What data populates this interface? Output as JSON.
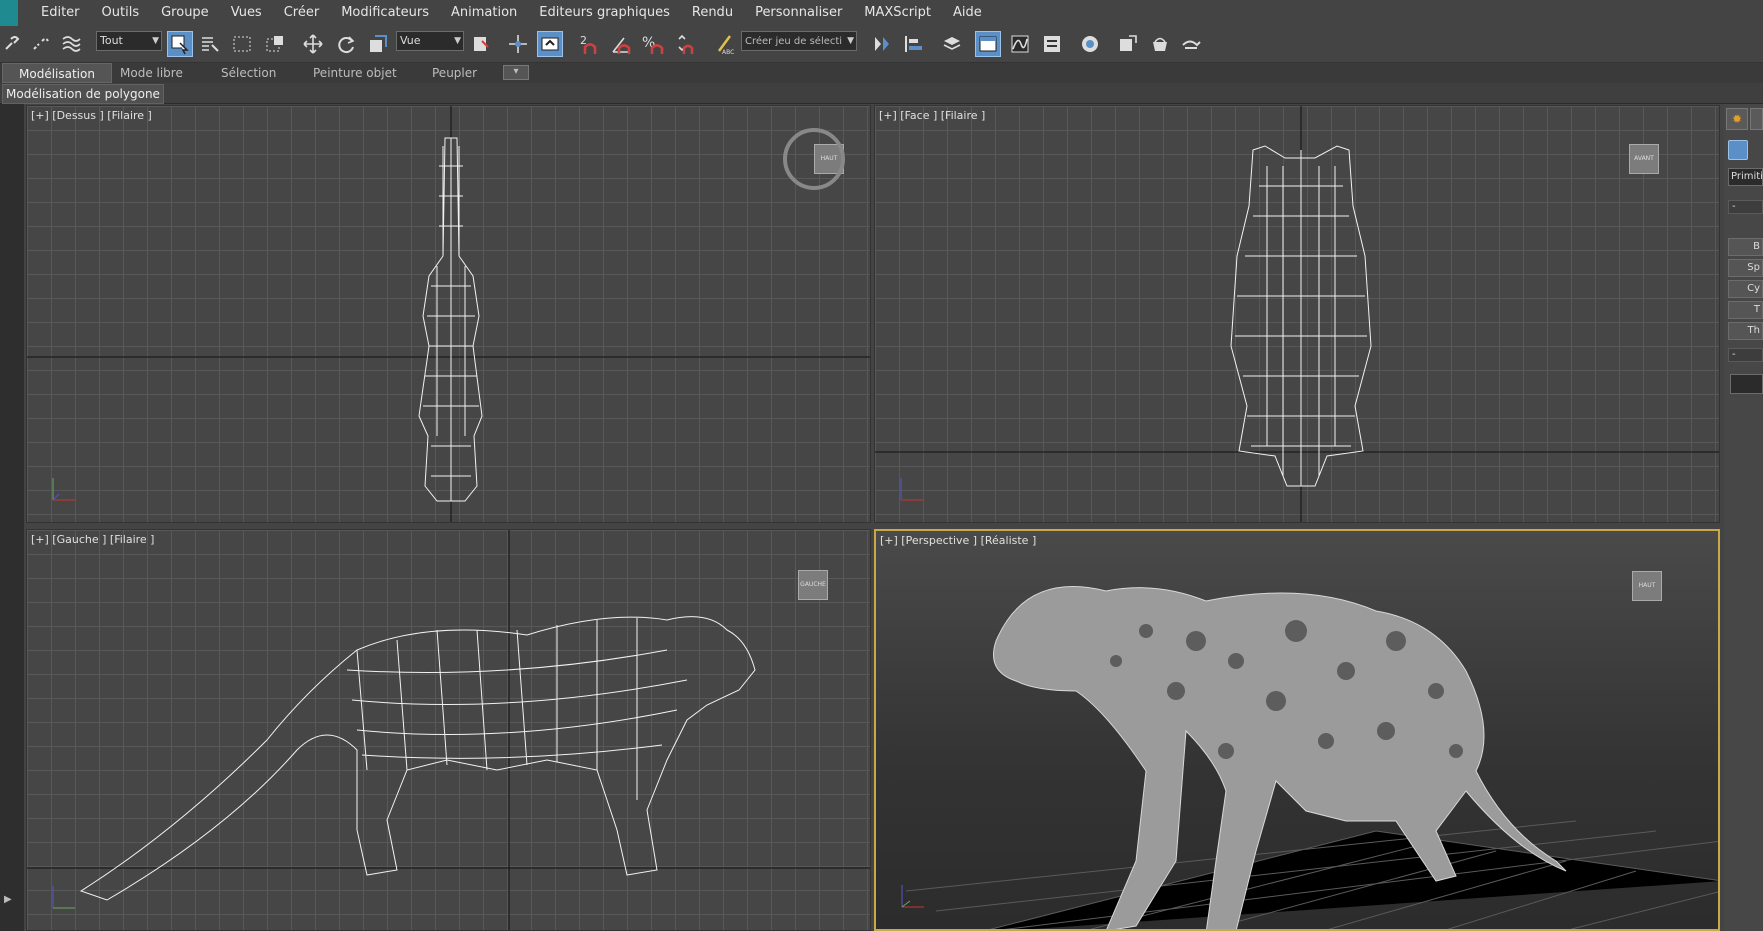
{
  "menu": {
    "items": [
      "Editer",
      "Outils",
      "Groupe",
      "Vues",
      "Créer",
      "Modificateurs",
      "Animation",
      "Editeurs graphiques",
      "Rendu",
      "Personnaliser",
      "MAXScript",
      "Aide"
    ]
  },
  "toolbar": {
    "selection_filter": "Tout",
    "reference_coord": "Vue",
    "named_selection_placeholder": "Créer jeu de sélecti",
    "snap_2d_label": "2",
    "percent_snap_label": "%"
  },
  "ribbon": {
    "tabs": [
      "Modélisation",
      "Mode libre",
      "Sélection",
      "Peinture objet",
      "Peupler"
    ],
    "active_tab": "Modélisation",
    "sub_label": "Modélisation de polygone"
  },
  "viewports": [
    {
      "label": "[+] [Dessus ] [Filaire ]",
      "cube": "HAUT"
    },
    {
      "label": "[+] [Face ] [Filaire ]",
      "cube": "AVANT"
    },
    {
      "label": "[+] [Gauche ] [Filaire ]",
      "cube": "GAUCHE"
    },
    {
      "label": "[+] [Perspective ] [Réaliste ]",
      "cube": "HAUT"
    }
  ],
  "command_panel": {
    "dropdown": "Primiti",
    "buttons": [
      "B",
      "Sp",
      "Cy",
      "T",
      "Th"
    ]
  },
  "colors": {
    "accent_active": "#5b8fc7",
    "perspective_border": "#c9a84a",
    "app_logo": "#1f8a8f"
  }
}
